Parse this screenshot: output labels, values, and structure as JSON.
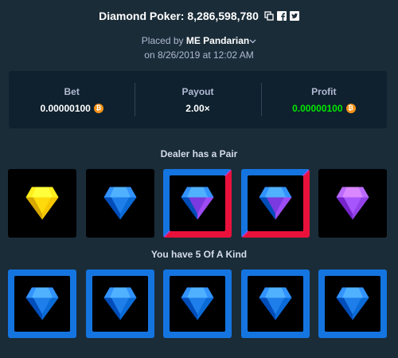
{
  "header": {
    "title": "Diamond Poker: 8,286,598,780",
    "copy_icon": "copy-icon",
    "facebook_icon": "facebook-icon",
    "twitter_icon": "twitter-icon"
  },
  "placed": {
    "prefix": "Placed by",
    "username": "ME Pandarian",
    "date": "on 8/26/2019 at 12:02 AM"
  },
  "stats": {
    "bet_label": "Bet",
    "bet_value": "0.00000100",
    "payout_label": "Payout",
    "payout_value": "2.00×",
    "profit_label": "Profit",
    "profit_value": "0.00000100",
    "currency_symbol": "₿"
  },
  "dealer": {
    "title": "Dealer has a Pair",
    "gems": [
      {
        "color": "yellow",
        "hex": "#ffd000",
        "frame": "none"
      },
      {
        "color": "blue",
        "hex": "#1475e1",
        "frame": "none"
      },
      {
        "color": "blue-purple",
        "hex": "#1475e1",
        "frame": "split"
      },
      {
        "color": "blue-purple",
        "hex": "#1475e1",
        "frame": "split"
      },
      {
        "color": "purple",
        "hex": "#9d4cf3",
        "frame": "none"
      }
    ]
  },
  "player": {
    "title": "You have 5 Of A Kind",
    "gems": [
      {
        "color": "blue",
        "hex": "#1475e1",
        "frame": "blue"
      },
      {
        "color": "blue",
        "hex": "#1475e1",
        "frame": "blue"
      },
      {
        "color": "blue",
        "hex": "#1475e1",
        "frame": "blue"
      },
      {
        "color": "blue",
        "hex": "#1475e1",
        "frame": "blue"
      },
      {
        "color": "blue",
        "hex": "#1475e1",
        "frame": "blue"
      }
    ]
  },
  "colors": {
    "background": "#1a2c38",
    "panel": "#0f212e",
    "profit_green": "#00e701",
    "accent_blue": "#1475e1",
    "accent_red": "#e9113c",
    "accent_purple": "#9d4cf3"
  }
}
